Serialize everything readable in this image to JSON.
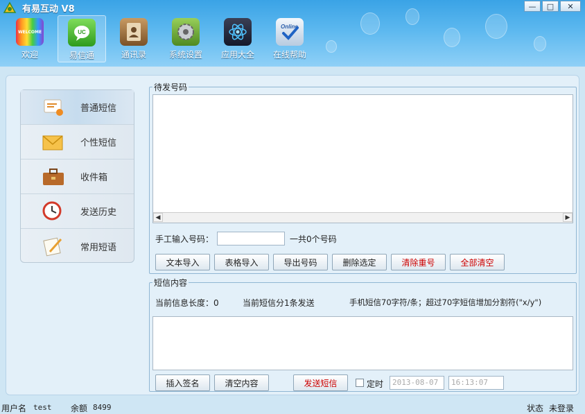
{
  "app": {
    "title": "有易互动 V8"
  },
  "window_controls": {
    "minimize": "—",
    "maximize": "□",
    "close": "✕"
  },
  "nav": [
    {
      "label": "欢迎",
      "icon": "welcome-icon"
    },
    {
      "label": "易信通",
      "icon": "message-icon",
      "active": true
    },
    {
      "label": "通讯录",
      "icon": "contacts-book-icon"
    },
    {
      "label": "系统设置",
      "icon": "gear-icon"
    },
    {
      "label": "应用大全",
      "icon": "apps-icon"
    },
    {
      "label": "在线帮助",
      "icon": "online-help-icon"
    }
  ],
  "welcome_badge": "WELCOME",
  "online_badge": "Online",
  "sidebar": [
    {
      "label": "普通短信",
      "icon": "sms-icon",
      "active": true
    },
    {
      "label": "个性短信",
      "icon": "envelope-icon"
    },
    {
      "label": "收件箱",
      "icon": "briefcase-icon"
    },
    {
      "label": "发送历史",
      "icon": "clock-icon"
    },
    {
      "label": "常用短语",
      "icon": "notepad-icon"
    }
  ],
  "numbers_panel": {
    "legend": "待发号码",
    "manual_label": "手工输入号码：",
    "manual_value": "",
    "count_text": "一共0个号码",
    "buttons": {
      "text_import": "文本导入",
      "table_import": "表格导入",
      "export": "导出号码",
      "delete_selected": "删除选定",
      "clear_dup": "清除重号",
      "clear_all": "全部清空"
    }
  },
  "sms_panel": {
    "legend": "短信内容",
    "length_text": "当前信息长度：0",
    "split_text": "当前短信分1条发送",
    "rule_text": "手机短信70字符/条；超过70字短信增加分割符(\"x/y\")",
    "buttons": {
      "insert_sign": "插入签名",
      "clear_content": "清空内容",
      "send": "发送短信"
    },
    "timer_label": "定时",
    "timer_checked": false,
    "date_value": "2013-08-07",
    "time_value": "16:13:07"
  },
  "status": {
    "user_label": "用户名",
    "user_value": "test",
    "balance_label": "余额",
    "balance_value": "8499",
    "state_label": "状态",
    "state_value": "未登录"
  },
  "colors": {
    "accent": "#3aa3e6",
    "danger": "#cc0000"
  }
}
